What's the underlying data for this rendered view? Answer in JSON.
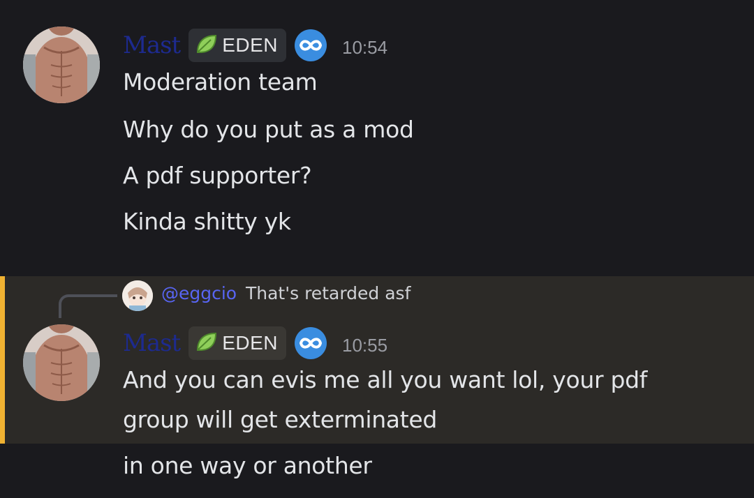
{
  "colors": {
    "background": "#1a1a1e",
    "highlight_background": "#2c2a27",
    "mention_bar": "#f0b232",
    "username": "#1d2a8f",
    "mention": "#5865f2",
    "boost_badge": "#3a8de0",
    "timestamp": "#9a9ca3"
  },
  "messages": [
    {
      "username": "Mast",
      "tag": {
        "label": "EDEN",
        "icon": "leaf-icon"
      },
      "badge_icon": "infinity-icon",
      "timestamp": "10:54",
      "lines": [
        "Moderation team",
        "Why do you put as a mod",
        "A pdf supporter?",
        "Kinda shitty yk"
      ]
    },
    {
      "reply": {
        "mention": "@eggcio",
        "text": "That's retarded asf"
      },
      "username": "Mast",
      "tag": {
        "label": "EDEN",
        "icon": "leaf-icon"
      },
      "badge_icon": "infinity-icon",
      "timestamp": "10:55",
      "lines": [
        "And you can evis me all you want lol, your pdf",
        "group will get exterminated",
        "in one way or another"
      ]
    }
  ]
}
